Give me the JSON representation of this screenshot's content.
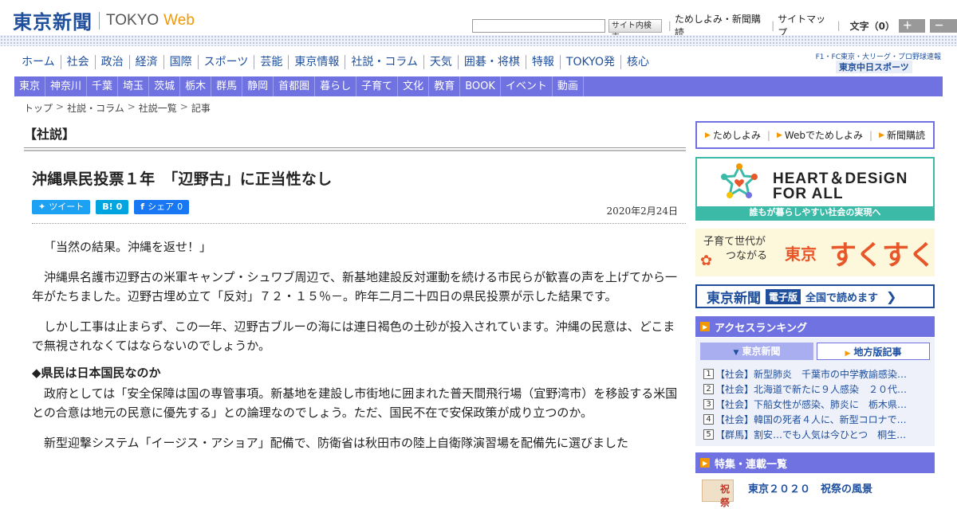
{
  "header": {
    "logo_jp": "東京新聞",
    "logo_en": "TOKYO",
    "logo_web": "Web",
    "search_button": "サイト内検索",
    "links": [
      "ためしよみ・新聞購読",
      "サイトマップ"
    ],
    "font_size_label": "文字（0）",
    "font_plus": "＋大",
    "font_minus": "－小"
  },
  "nav_primary": [
    "ホーム",
    "社会",
    "政治",
    "経済",
    "国際",
    "スポーツ",
    "芸能",
    "東京情報",
    "社説・コラム",
    "天気",
    "囲碁・将棋",
    "特報",
    "TOKYO発",
    "核心"
  ],
  "nav_side_note": "F1・FC東京・大リーグ・プロ野球速報",
  "nav_side_brand": "東京中日スポーツ",
  "nav_regional": [
    "東京",
    "神奈川",
    "千葉",
    "埼玉",
    "茨城",
    "栃木",
    "群馬",
    "静岡",
    "首都圏",
    "暮らし",
    "子育て",
    "文化",
    "教育",
    "BOOK",
    "イベント",
    "動画"
  ],
  "breadcrumb": [
    "トップ",
    "社説・コラム",
    "社説一覧",
    "記事"
  ],
  "article": {
    "section": "【社説】",
    "title": "沖縄県民投票１年　「辺野古」に正当性なし",
    "date": "2020年2月24日",
    "share": {
      "tweet": "ツイート",
      "hatena": "B!",
      "hatena_count": "0",
      "facebook": "シェア",
      "facebook_count": "0"
    },
    "paragraphs": [
      "「当然の結果。沖縄を返せ！」",
      "沖縄県名護市辺野古の米軍キャンプ・シュワブ周辺で、新基地建設反対運動を続ける市民らが歓喜の声を上げてから一年がたちました。辺野古埋め立て「反対」７２・１５％－。昨年二月二十四日の県民投票が示した結果です。",
      "しかし工事は止まらず、この一年、辺野古ブルーの海には連日褐色の土砂が投入されています。沖縄の民意は、どこまで無視されなくてはならないのでしょうか。"
    ],
    "subhead": "◆県民は日本国民なのか",
    "paragraphs2": [
      "政府としては「安全保障は国の専管事項。新基地を建設し市街地に囲まれた普天間飛行場（宜野湾市）を移設する米国との合意は地元の民意に優先する」との論理なのでしょう。ただ、国民不在で安保政策が成り立つのか。",
      "新型迎撃システム「イージス・アショア」配備で、防衛省は秋田市の陸上自衛隊演習場を配備先に選びました"
    ]
  },
  "sidebar": {
    "links": [
      "ためしよみ",
      "Webでためしよみ",
      "新聞購読"
    ],
    "heart_design": {
      "line1": "HEART＆DESiGN",
      "line2": "FOR ALL",
      "footer": "誰もが暮らしやすい社会の実現へ"
    },
    "kosodate": {
      "sub1": "子育て世代が",
      "sub2": "つながる",
      "tokyo": "東京",
      "main": "すくすく"
    },
    "eban": {
      "title": "東京新聞",
      "badge": "電子版",
      "text": "全国で読めます"
    },
    "ranking": {
      "title": "アクセスランキング",
      "tabs": [
        "東京新聞",
        "地方版記事"
      ],
      "items": [
        "【社会】新型肺炎　千葉市の中学教諭感染…",
        "【社会】北海道で新たに９人感染　２０代…",
        "【社会】下船女性が感染、肺炎に　栃木県…",
        "【社会】韓国の死者４人に、新型コロナで…",
        "【群馬】割安…でも人気は今ひとつ　桐生…"
      ]
    },
    "features": {
      "title": "特集・連載一覧",
      "first_item": "東京２０２０　祝祭の風景",
      "thumb_label": "祝祭"
    }
  },
  "colors": {
    "brand_blue": "#1f4f9c",
    "nav_purple": "#6f72e0",
    "accent_orange": "#f39800",
    "teal": "#3cbaa8"
  }
}
